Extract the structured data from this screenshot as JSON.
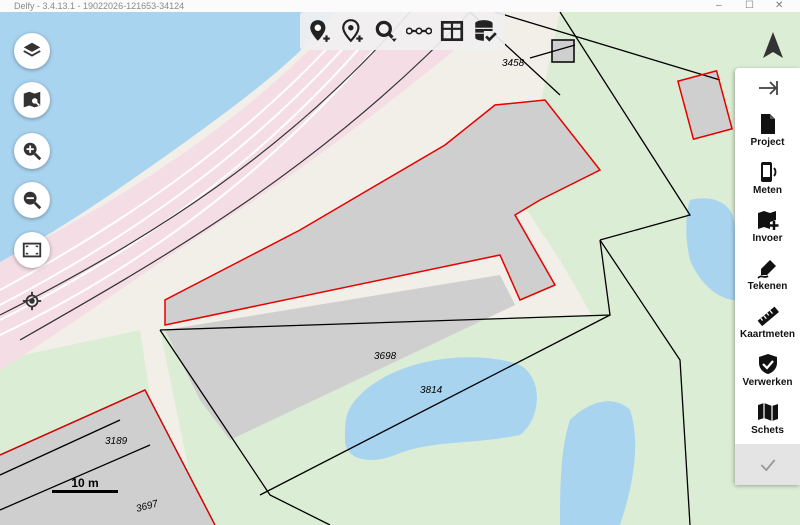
{
  "window": {
    "title": "Delfy - 3.4.13.1 - 19022026-121653-34124",
    "controls": [
      "–",
      "☐",
      "✕"
    ]
  },
  "map_tools_left": [
    {
      "icon": "layers-icon"
    },
    {
      "icon": "map-search-icon"
    },
    {
      "icon": "zoom-in-icon"
    },
    {
      "icon": "zoom-out-icon"
    },
    {
      "icon": "zoom-extent-icon"
    },
    {
      "icon": "gps-locate-icon"
    }
  ],
  "top_toolbar": [
    {
      "icon": "add-point-icon"
    },
    {
      "icon": "add-point-outline-icon"
    },
    {
      "icon": "search-location-icon"
    },
    {
      "icon": "line-tool-icon"
    },
    {
      "icon": "table-icon"
    },
    {
      "icon": "database-check-icon"
    }
  ],
  "right_panel": {
    "collapse_icon": "arrow-collapse-icon",
    "items": [
      {
        "label": "Project",
        "icon": "document-icon"
      },
      {
        "label": "Meten",
        "icon": "measure-device-icon"
      },
      {
        "label": "Invoer",
        "icon": "map-add-icon"
      },
      {
        "label": "Tekenen",
        "icon": "draw-icon"
      },
      {
        "label": "Kaartmeten",
        "icon": "ruler-icon"
      },
      {
        "label": "Verwerken",
        "icon": "shield-check-icon"
      },
      {
        "label": "Schets",
        "icon": "map-icon"
      }
    ],
    "confirm_icon": "check-icon"
  },
  "map": {
    "parcel_numbers": [
      "3458",
      "3698",
      "3814",
      "3189",
      "3697"
    ],
    "scale_label": "10 m",
    "colors": {
      "water": "#a9d4f0",
      "land": "#f2efe9",
      "grass": "#dcedd5",
      "building": "#cfcfcf",
      "rail_area": "#f5dde6",
      "parcel_edge": "#000000",
      "selection": "#e60000"
    }
  }
}
